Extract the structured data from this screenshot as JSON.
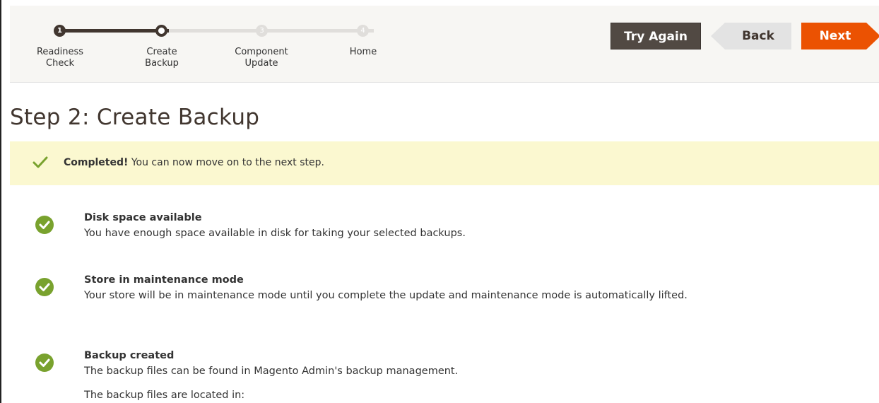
{
  "progress": {
    "steps": [
      {
        "number": "1",
        "label_line1": "Readiness",
        "label_line2": "Check",
        "state": "done"
      },
      {
        "number": "",
        "label_line1": "Create",
        "label_line2": "Backup",
        "state": "current"
      },
      {
        "number": "3",
        "label_line1": "Component",
        "label_line2": "Update",
        "state": "future"
      },
      {
        "number": "4",
        "label_line1": "Home",
        "label_line2": "",
        "state": "future"
      }
    ]
  },
  "buttons": {
    "try_again": "Try Again",
    "back": "Back",
    "next": "Next"
  },
  "page": {
    "title": "Step 2: Create Backup"
  },
  "notice": {
    "strong": "Completed!",
    "text": " You can now move on to the next step."
  },
  "checks": [
    {
      "title": "Disk space available",
      "description": "You have enough space available in disk for taking your selected backups.",
      "extra": ""
    },
    {
      "title": "Store in maintenance mode",
      "description": "Your store will be in maintenance mode until you complete the update and maintenance mode is automatically lifted.",
      "extra": ""
    },
    {
      "title": "Backup created",
      "description": "The backup files can be found in Magento Admin's backup management.",
      "extra": "The backup files are located in:"
    }
  ],
  "colors": {
    "accent_next": "#eb5202",
    "dark_button": "#514943",
    "success_green": "#79a22e",
    "notice_bg": "#fbf8d0"
  },
  "icons": {
    "step_done": "number-dot",
    "step_current": "ring-dot",
    "status": "check-circle-icon",
    "notice": "checkmark-icon"
  }
}
